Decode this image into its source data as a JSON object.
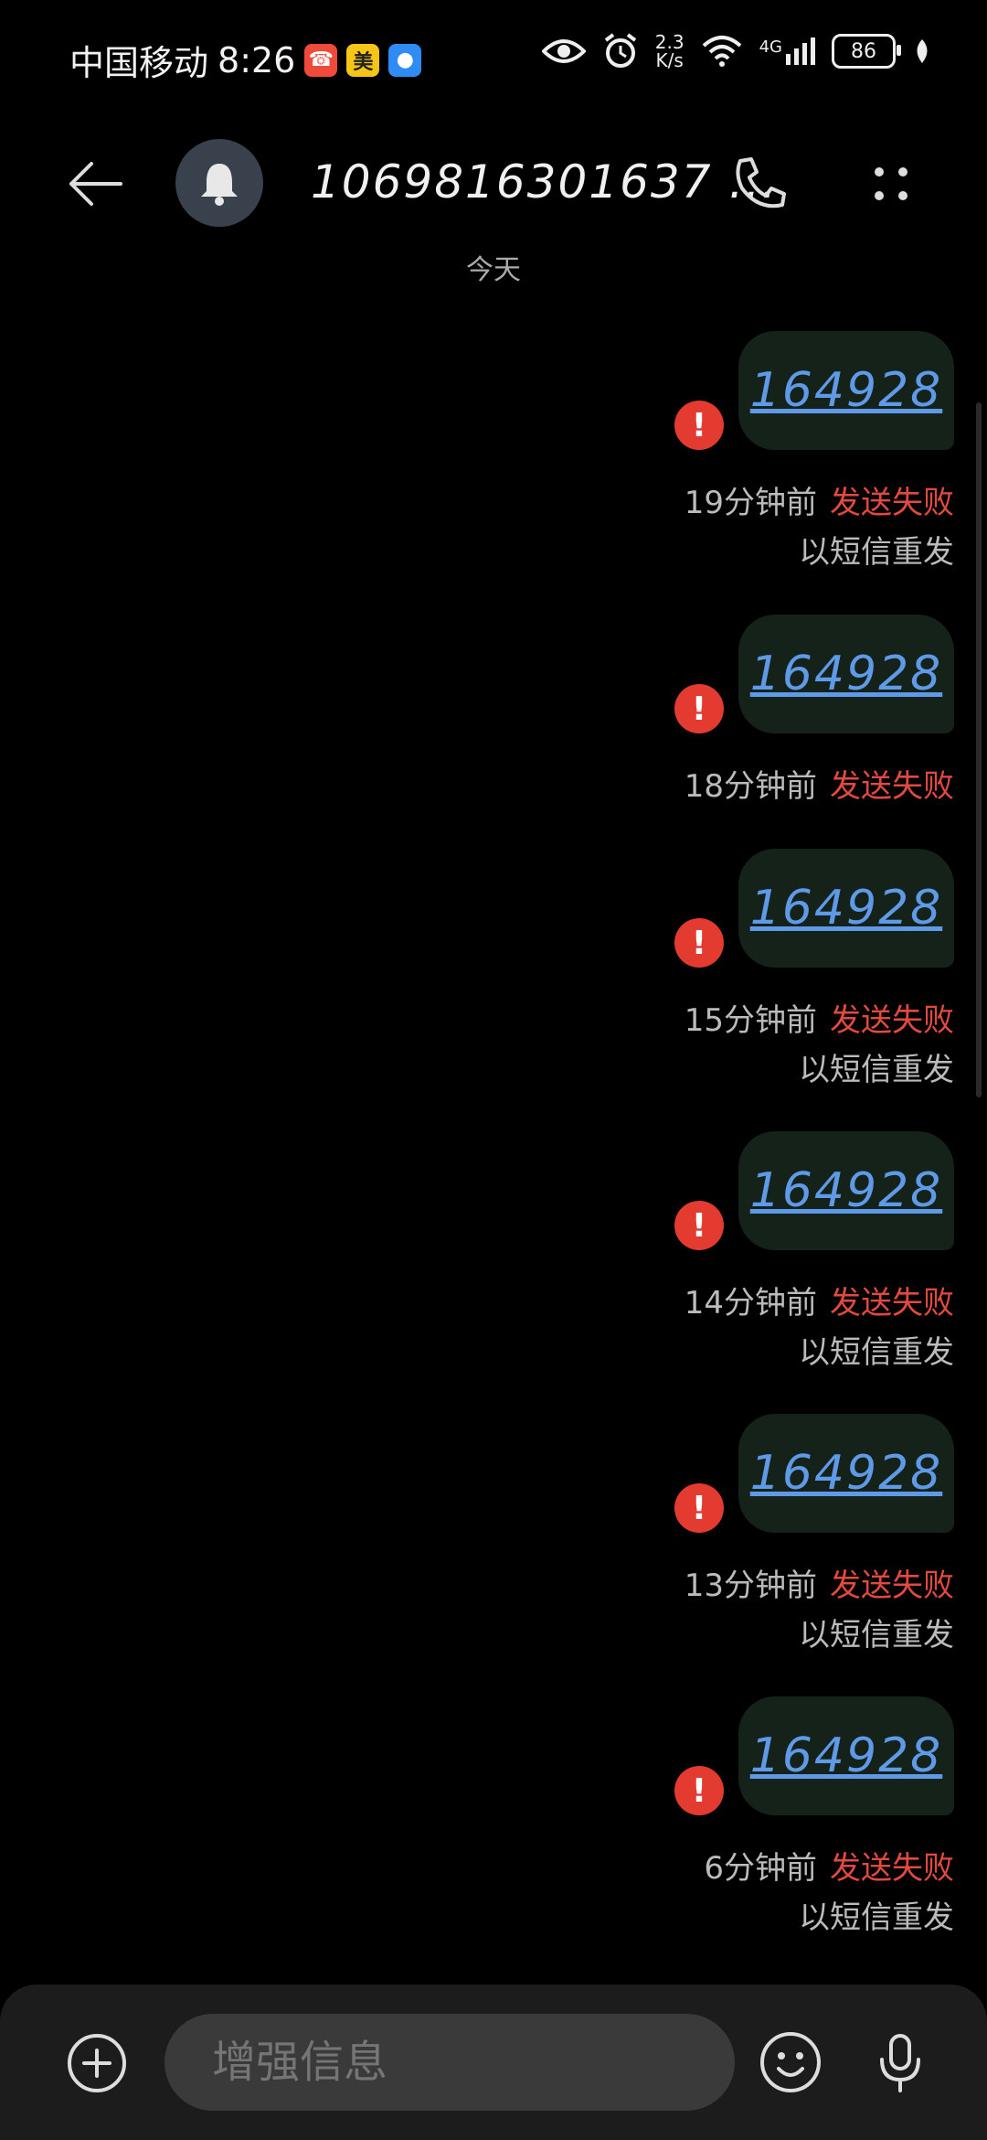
{
  "status_bar": {
    "carrier": "中国移动",
    "time": "8:26",
    "app_badges": [
      "missed-call",
      "美",
      "message"
    ],
    "net_speed_value": "2.3",
    "net_speed_unit": "K/s",
    "network": "4G",
    "battery": "86"
  },
  "header": {
    "contact": "1069816301637 ...",
    "icons": [
      "back-arrow-icon",
      "bell-icon",
      "phone-icon",
      "more-icon"
    ]
  },
  "date_divider": "今天",
  "messages": [
    {
      "text": "164928",
      "time": "19分钟前",
      "status": "发送失败",
      "resend": "以短信重发"
    },
    {
      "text": "164928",
      "time": "18分钟前",
      "status": "发送失败",
      "resend": ""
    },
    {
      "text": "164928",
      "time": "15分钟前",
      "status": "发送失败",
      "resend": "以短信重发"
    },
    {
      "text": "164928",
      "time": "14分钟前",
      "status": "发送失败",
      "resend": "以短信重发"
    },
    {
      "text": "164928",
      "time": "13分钟前",
      "status": "发送失败",
      "resend": "以短信重发"
    },
    {
      "text": "164928",
      "time": "6分钟前",
      "status": "发送失败",
      "resend": "以短信重发"
    }
  ],
  "composer": {
    "placeholder": "增强信息"
  },
  "colors": {
    "background": "#000000",
    "bubble": "#14221a",
    "link_text": "#5f9ae8",
    "error": "#e33b30",
    "fail_text": "#e24a3f"
  }
}
